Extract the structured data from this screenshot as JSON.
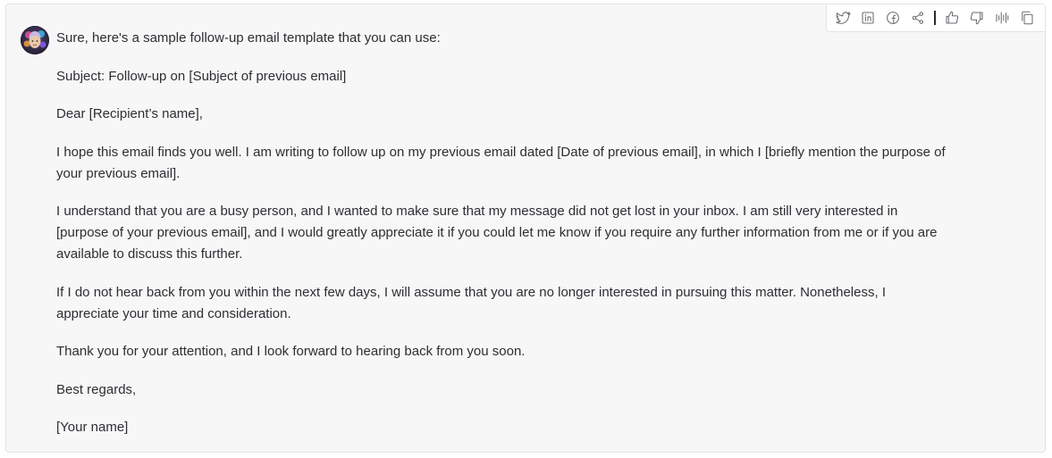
{
  "toolbar": {
    "icons": [
      "twitter-icon",
      "linkedin-icon",
      "facebook-icon",
      "share-icon",
      "thumbs-up-icon",
      "thumbs-down-icon",
      "audio-waveform-icon",
      "copy-icon"
    ]
  },
  "message": {
    "paragraphs": [
      "Sure, here's a sample follow-up email template that you can use:",
      "Subject: Follow-up on [Subject of previous email]",
      "Dear [Recipient’s name],",
      "I hope this email finds you well. I am writing to follow up on my previous email dated [Date of previous email], in which I [briefly mention the purpose of your previous email].",
      "I understand that you are a busy person, and I wanted to make sure that my message did not get lost in your inbox. I am still very interested in [purpose of your previous email], and I would greatly appreciate it if you could let me know if you require any further information from me or if you are available to discuss this further.",
      "If I do not hear back from you within the next few days, I will assume that you are no longer interested in pursuing this matter. Nonetheless, I appreciate your time and consideration.",
      "Thank you for your attention, and I look forward to hearing back from you soon.",
      "Best regards,",
      "[Your name]"
    ]
  }
}
